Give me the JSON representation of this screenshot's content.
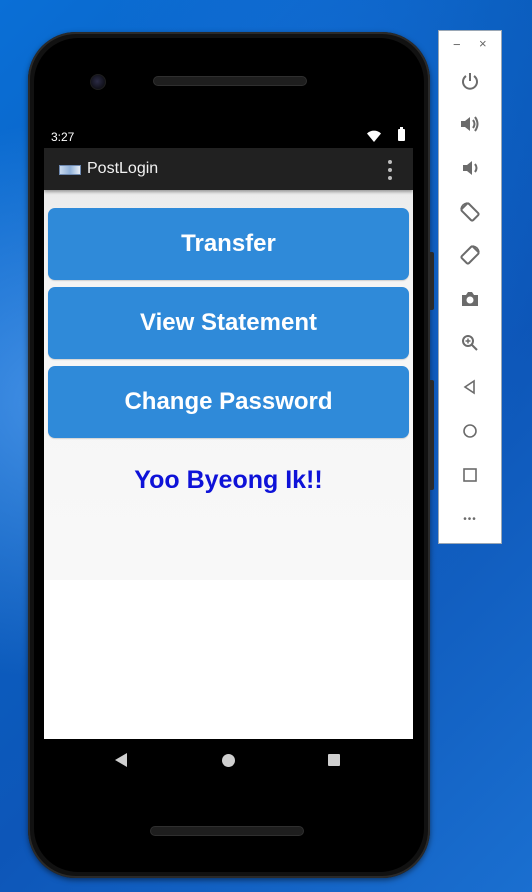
{
  "status_bar": {
    "time": "3:27"
  },
  "app_bar": {
    "title": "PostLogin"
  },
  "buttons": {
    "transfer": "Transfer",
    "view_statement": "View Statement",
    "change_password": "Change Password"
  },
  "greeting": "Yoo Byeong Ik!!",
  "emulator_toolbar": {
    "minimize_glyph": "−",
    "close_glyph": "×",
    "more_glyph": "•••",
    "items": [
      "power-icon",
      "volume-up-icon",
      "volume-down-icon",
      "rotate-left-icon",
      "rotate-right-icon",
      "camera-icon",
      "zoom-icon",
      "back-icon",
      "home-icon",
      "overview-icon",
      "more-icon"
    ]
  },
  "colors": {
    "button": "#2f8ad9",
    "greeting": "#0e12d8",
    "app_bar": "#212121",
    "desktop": "#0b5fc0"
  }
}
